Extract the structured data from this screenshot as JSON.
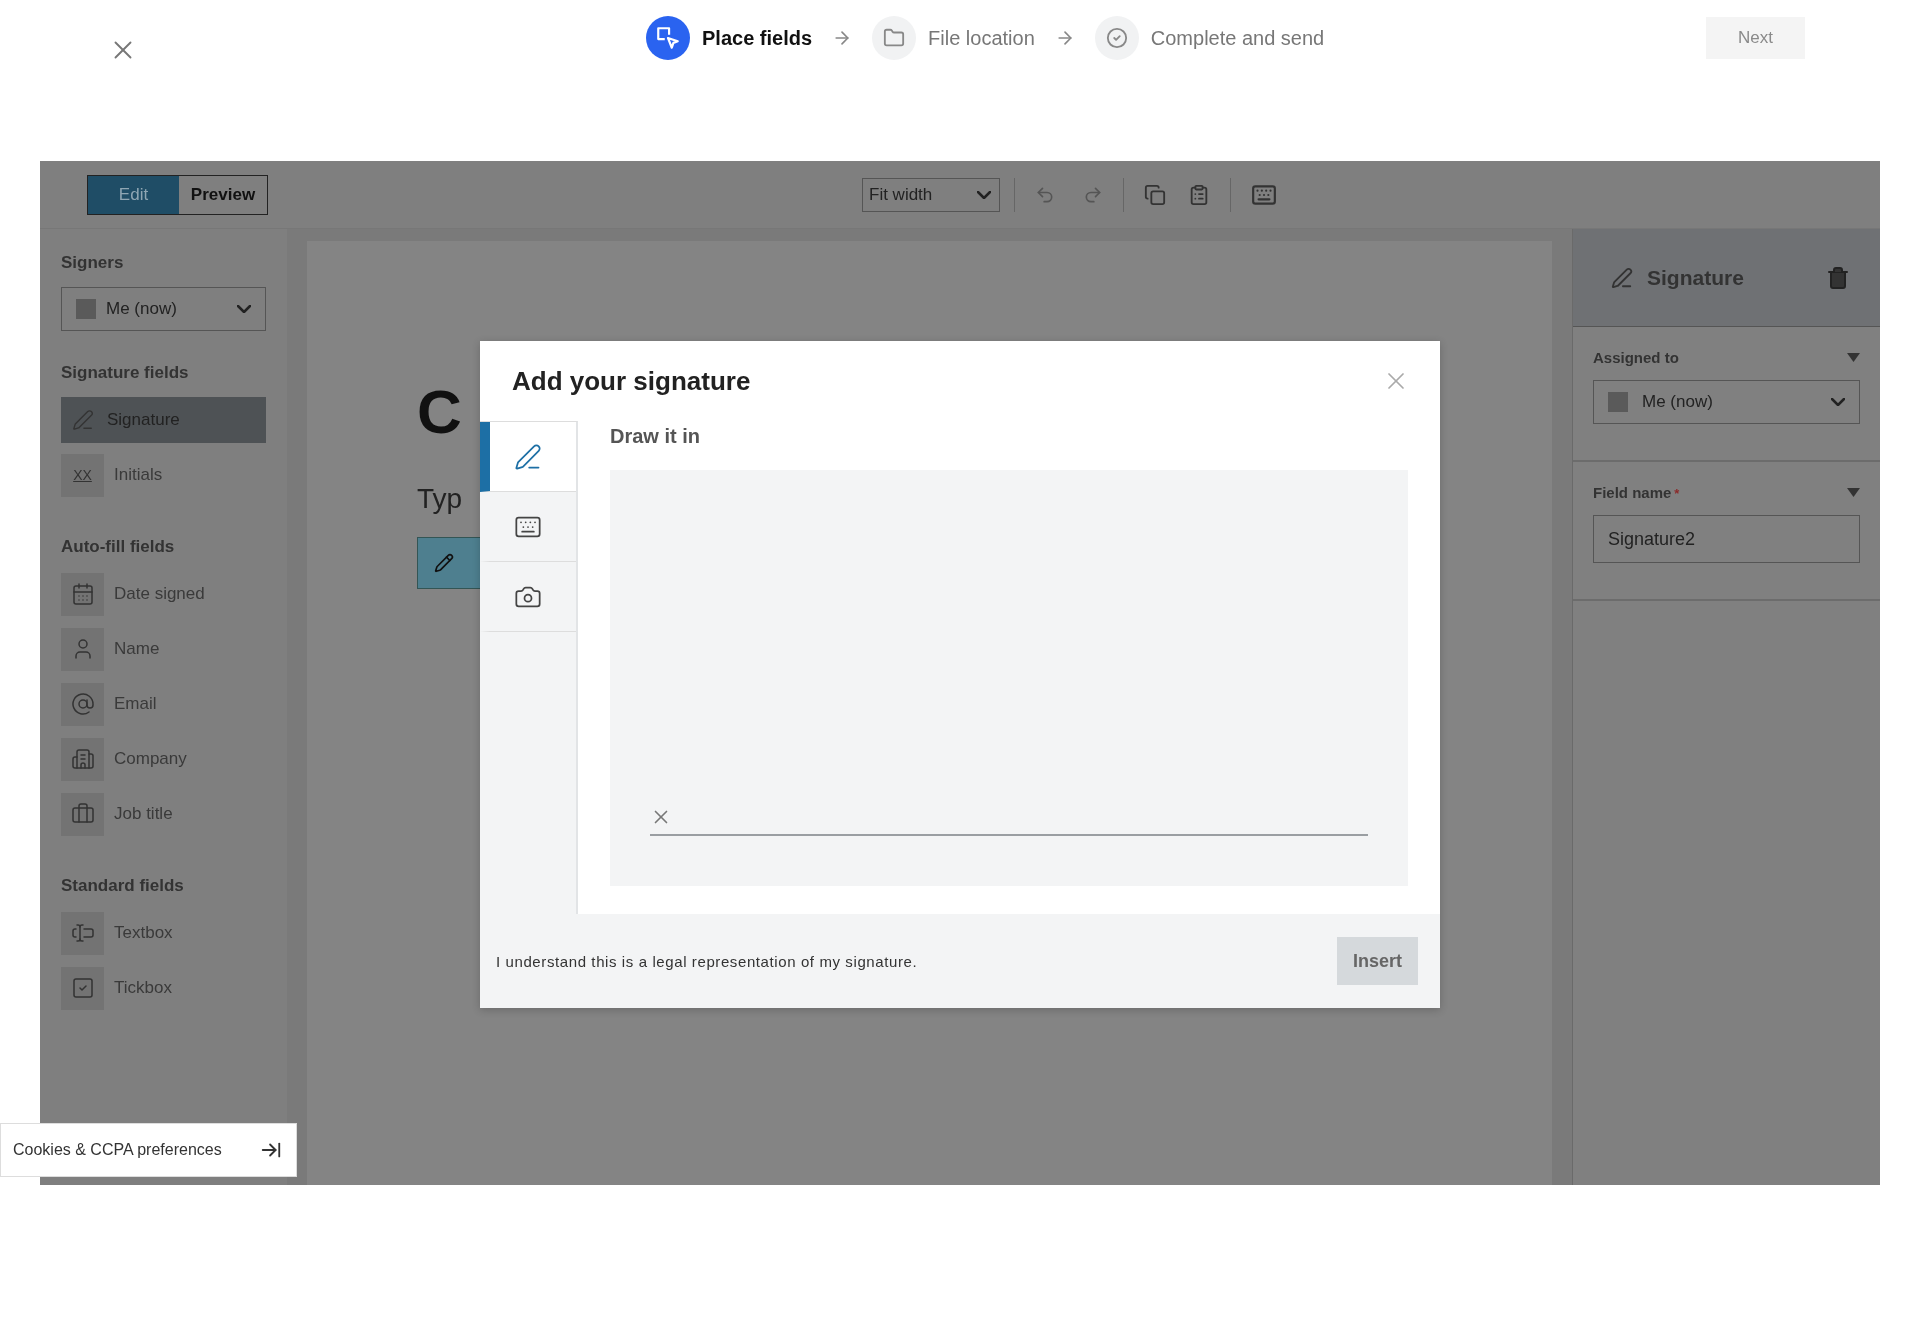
{
  "header": {
    "steps": [
      {
        "label": "Place fields",
        "kind": "place",
        "selected": true
      },
      {
        "label": "File location",
        "kind": "folder",
        "selected": false
      },
      {
        "label": "Complete and send",
        "kind": "check",
        "selected": false
      }
    ],
    "next_button": {
      "label": "Next",
      "disabled": true
    }
  },
  "toolbar": {
    "view_modes": [
      {
        "label": "Edit",
        "selected": true
      },
      {
        "label": "Preview",
        "selected": false
      }
    ],
    "zoom": "Fit width"
  },
  "sidebar": {
    "signers_label": "Signers",
    "signer": "Me (now)",
    "groups": [
      {
        "title": "Signature fields",
        "items": [
          {
            "label": "Signature",
            "kind": "pen",
            "selected": true
          },
          {
            "label": "Initials",
            "kind": "initials",
            "icon_text": "XX",
            "selected": false
          }
        ]
      },
      {
        "title": "Auto-fill fields",
        "items": [
          {
            "label": "Date signed",
            "kind": "date",
            "selected": false
          },
          {
            "label": "Name",
            "kind": "person",
            "selected": false
          },
          {
            "label": "Email",
            "kind": "at",
            "selected": false
          },
          {
            "label": "Company",
            "kind": "building",
            "selected": false
          },
          {
            "label": "Job title",
            "kind": "briefcase",
            "selected": false
          }
        ]
      },
      {
        "title": "Standard fields",
        "items": [
          {
            "label": "Textbox",
            "kind": "textbox",
            "selected": false
          },
          {
            "label": "Tickbox",
            "kind": "tickbox",
            "selected": false
          }
        ]
      }
    ]
  },
  "document": {
    "heading": "C",
    "line": "Typ"
  },
  "properties": {
    "title": "Signature",
    "assigned_label": "Assigned to",
    "assigned_value": "Me (now)",
    "field_label": "Field name",
    "field_required_mark": "*",
    "field_value": "Signature2"
  },
  "modal": {
    "title": "Add your signature",
    "section": "Draw it in",
    "tabs": [
      {
        "kind": "draw",
        "selected": true
      },
      {
        "kind": "type",
        "selected": false
      },
      {
        "kind": "upload",
        "selected": false
      }
    ],
    "consent": "I understand this is a legal representation of my signature.",
    "insert_button": {
      "label": "Insert",
      "disabled": true
    }
  },
  "cookies": {
    "label": "Cookies & CCPA preferences"
  }
}
